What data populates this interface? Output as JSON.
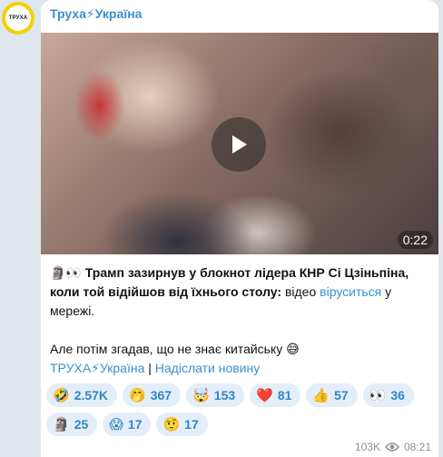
{
  "channel": {
    "name": "Труха⚡Україна",
    "avatar_text": "ТРУХА"
  },
  "video": {
    "duration": "0:22"
  },
  "post": {
    "emoji_prefix": "🗿👀",
    "headline_bold": "Трамп зазирнув у блокнот лідера КНР Сі Цзіньпіна, коли той відійшов від їхнього столу:",
    "text_middle": " відео ",
    "link_text": "віруситься",
    "text_end": " у мережі.",
    "second_line": "Але потім згадав, що не знає китайську 😅"
  },
  "footer": {
    "channel_link": "ТРУХА⚡Україна",
    "separator": " | ",
    "submit_link": "Надіслати новину"
  },
  "reactions": [
    {
      "emoji": "🤣",
      "count": "2.57K"
    },
    {
      "emoji": "🤭",
      "count": "367"
    },
    {
      "emoji": "🤯",
      "count": "153"
    },
    {
      "emoji": "❤️",
      "count": "81"
    },
    {
      "emoji": "👍",
      "count": "57"
    },
    {
      "emoji": "👀",
      "count": "36"
    },
    {
      "emoji": "🗿",
      "count": "25"
    },
    {
      "emoji": "😱",
      "count": "17"
    },
    {
      "emoji": "🤨",
      "count": "17"
    }
  ],
  "meta": {
    "views": "103K",
    "time": "08:21"
  },
  "colors": {
    "accent": "#3a8fd0",
    "reaction_bg": "#e3eef8",
    "background": "#dfe6ee"
  }
}
